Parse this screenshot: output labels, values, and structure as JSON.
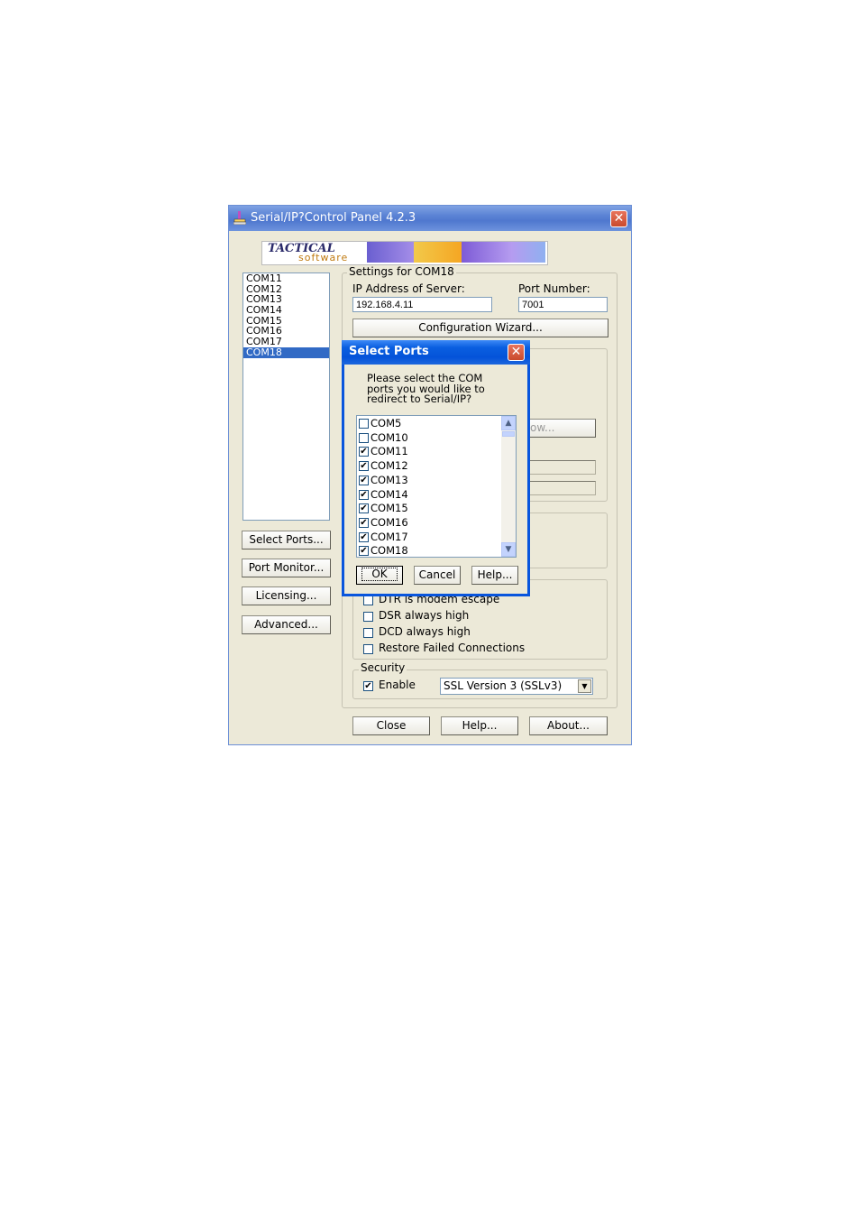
{
  "main_window": {
    "title": "Serial/IP?Control Panel 4.2.3",
    "close_glyph": "✕",
    "banner": {
      "brand_top": "TACTICAL",
      "brand_bottom": "software"
    },
    "com_list": [
      "COM11",
      "COM12",
      "COM13",
      "COM14",
      "COM15",
      "COM16",
      "COM17",
      "COM18"
    ],
    "selected_com": "COM18",
    "side_buttons": {
      "select_ports": "Select Ports...",
      "port_monitor": "Port Monitor...",
      "licensing": "Licensing...",
      "advanced": "Advanced..."
    },
    "settings": {
      "group_label": "Settings for COM18",
      "ip_label": "IP Address of Server:",
      "ip_value": "192.168.4.11",
      "port_label": "Port Number:",
      "port_value": "7001",
      "config_wizard": "Configuration Wizard...",
      "partial_button": "ow...",
      "options": [
        {
          "label": "DTR is modem escape",
          "checked": false
        },
        {
          "label": "DSR always high",
          "checked": false
        },
        {
          "label": "DCD always high",
          "checked": false
        },
        {
          "label": "Restore Failed Connections",
          "checked": false
        }
      ],
      "security": {
        "group_label": "Security",
        "enable_label": "Enable",
        "enable_checked": true,
        "ssl_value": "SSL Version 3 (SSLv3)"
      }
    },
    "bottom_buttons": {
      "close": "Close",
      "help": "Help...",
      "about": "About..."
    }
  },
  "dialog": {
    "title": "Select Ports",
    "close_glyph": "✕",
    "prompt_line1": "Please select the COM",
    "prompt_line2": "ports you would like to",
    "prompt_line3": "redirect to Serial/IP?",
    "ports": [
      {
        "name": "COM5",
        "checked": false
      },
      {
        "name": "COM10",
        "checked": false
      },
      {
        "name": "COM11",
        "checked": true
      },
      {
        "name": "COM12",
        "checked": true
      },
      {
        "name": "COM13",
        "checked": true
      },
      {
        "name": "COM14",
        "checked": true
      },
      {
        "name": "COM15",
        "checked": true
      },
      {
        "name": "COM16",
        "checked": true
      },
      {
        "name": "COM17",
        "checked": true
      },
      {
        "name": "COM18",
        "checked": true
      }
    ],
    "buttons": {
      "ok": "OK",
      "cancel": "Cancel",
      "help": "Help..."
    }
  },
  "icons": {
    "check": "✔",
    "scroll_up": "▲",
    "scroll_down": "▼",
    "dropdown": "▼"
  },
  "colors": {
    "titlebar": "#5a82d4",
    "dialog_titlebar": "#0453d9",
    "selection": "#316ac5",
    "window_bg": "#ece9d8"
  }
}
